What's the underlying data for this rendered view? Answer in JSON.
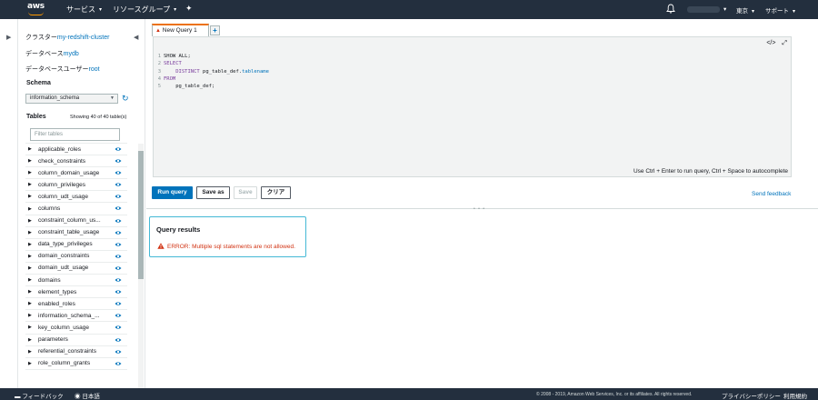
{
  "nav": {
    "logo_text": "aws",
    "services": "サービス",
    "resource_groups": "リソースグループ",
    "region": "東京",
    "support": "サポート"
  },
  "sidebar": {
    "cluster_label": "クラスター",
    "cluster_value": "my-redshift-cluster",
    "database_label": "データベース",
    "database_value": "mydb",
    "user_label": "データベースユーザー",
    "user_value": "root",
    "schema_title": "Schema",
    "schema_selected": "information_schema",
    "tables_title": "Tables",
    "tables_count": "Showing 40 of 40 table(s)",
    "filter_placeholder": "Filter tables",
    "tables": [
      "applicable_roles",
      "check_constraints",
      "column_domain_usage",
      "column_privileges",
      "column_udt_usage",
      "columns",
      "constraint_column_us...",
      "constraint_table_usage",
      "data_type_privileges",
      "domain_constraints",
      "domain_udt_usage",
      "domains",
      "element_types",
      "enabled_roles",
      "information_schema_...",
      "key_column_usage",
      "parameters",
      "referential_constraints",
      "role_column_grants"
    ]
  },
  "editor": {
    "tab_label": "New Query 1",
    "tab_add": "+",
    "code_lines": [
      {
        "num": "1",
        "parts": [
          {
            "t": "SHOW ALL;",
            "c": "plain"
          }
        ]
      },
      {
        "num": "2",
        "parts": [
          {
            "t": "SELECT",
            "c": "kw"
          }
        ]
      },
      {
        "num": "3",
        "parts": [
          {
            "t": "    DISTINCT ",
            "c": "kw"
          },
          {
            "t": "pg_table_def.",
            "c": "plain"
          },
          {
            "t": "tablename",
            "c": "fld"
          }
        ]
      },
      {
        "num": "4",
        "parts": [
          {
            "t": "FROM",
            "c": "kw"
          }
        ]
      },
      {
        "num": "5",
        "parts": [
          {
            "t": "    pg_table_def;",
            "c": "plain"
          }
        ]
      }
    ],
    "hint": "Use Ctrl + Enter to run query, Ctrl + Space to autocomplete"
  },
  "actions": {
    "run": "Run query",
    "save_as": "Save as",
    "save": "Save",
    "clear": "クリア",
    "feedback": "Send feedback"
  },
  "results": {
    "title": "Query results",
    "error": "ERROR: Multiple sql statements are not allowed."
  },
  "footer": {
    "feedback": "フィードバック",
    "language": "日本語",
    "copyright": "© 2008 - 2019, Amazon Web Services, Inc. or its affiliates. All rights reserved.",
    "privacy": "プライバシーポリシー",
    "terms": "利用規約"
  },
  "colors": {
    "nav_bg": "#232f3e",
    "accent": "#ec7211",
    "link": "#0073bb",
    "error": "#d13212",
    "results_border": "#44b9d6"
  }
}
